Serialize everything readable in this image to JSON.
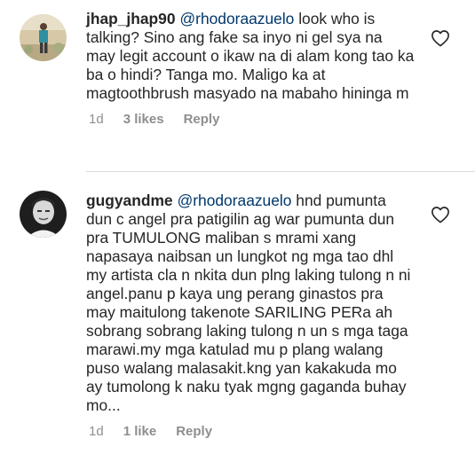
{
  "comments": [
    {
      "username": "jhap_jhap90",
      "mention": "@rhodoraazuelo",
      "text": " look who is talking? Sino ang fake sa inyo ni gel sya na may legit account o ikaw na di alam kong tao ka ba o hindi? Tanga mo. Maligo ka at magtoothbrush masyado na mabaho hininga m",
      "time": "1d",
      "likes": "3 likes",
      "reply": "Reply",
      "avatar_icon": "avatar-outdoor-photo-icon",
      "like_icon": "heart-outline-icon"
    },
    {
      "username": "gugyandme",
      "mention": "@rhodoraazuelo",
      "text": " hnd pumunta dun c angel pra patigilin ag war pumunta dun pra TUMULONG maliban s mrami xang napasaya naibsan un lungkot ng mga tao dhl my artista cla n nkita dun plng laking tulong n ni angel.panu p kaya ung perang ginastos pra may maitulong takenote SARILING PERa ah sobrang sobrang laking tulong n un s mga taga marawi.my mga katulad mu p plang walang puso walang malasakit.kng yan kakakuda mo ay tumolong k naku tyak mgng gaganda buhay mo...",
      "time": "1d",
      "likes": "1 like",
      "reply": "Reply",
      "avatar_icon": "avatar-portrait-photo-icon",
      "like_icon": "heart-outline-icon"
    }
  ],
  "colors": {
    "text": "#262626",
    "mention": "#00376b",
    "meta": "#8e8e8e",
    "divider": "#dbdbdb"
  }
}
